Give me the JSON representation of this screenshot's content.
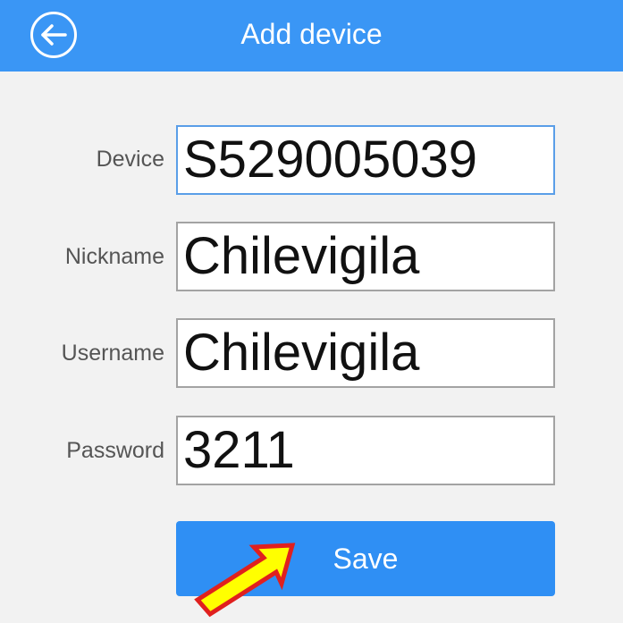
{
  "header": {
    "title": "Add device",
    "back_icon": "back-arrow-circle-icon"
  },
  "form": {
    "device": {
      "label": "Device",
      "value": "S529005039"
    },
    "nickname": {
      "label": "Nickname",
      "value": "Chilevigila"
    },
    "username": {
      "label": "Username",
      "value": "Chilevigila"
    },
    "password": {
      "label": "Password",
      "value": "3211"
    }
  },
  "save_label": "Save",
  "colors": {
    "header": "#3a96f5",
    "button": "#2f8ff4",
    "annotation_arrow_fill": "#ffff00",
    "annotation_arrow_outline": "#e0201e"
  }
}
